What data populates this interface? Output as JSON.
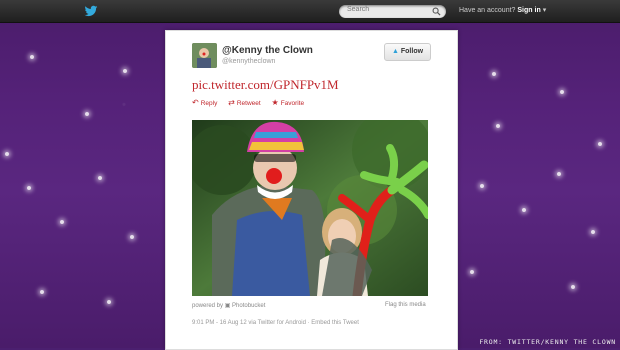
{
  "topbar": {
    "search_placeholder": "Search",
    "account_prompt": "Have an account?",
    "signin_label": "Sign in",
    "signin_caret": "▾"
  },
  "tweet": {
    "display_name": "@Kenny the Clown",
    "handle": "@kennytheclown",
    "follow_label": "Follow",
    "link_text": "pic.twitter.com/GPNFPv1M",
    "actions": {
      "reply": "Reply",
      "retweet": "Retweet",
      "favorite": "Favorite"
    },
    "powered_by": "powered by",
    "photo_service": "Photobucket",
    "flag_label": "Flag this media",
    "meta": "9:01 PM - 16 Aug 12 via Twitter for Android · Embed this Tweet"
  },
  "credit": "FROM: TWITTER/KENNY THE CLOWN",
  "colors": {
    "background": "#552279",
    "link": "#c0272d",
    "topbar": "#2a2a2a"
  }
}
